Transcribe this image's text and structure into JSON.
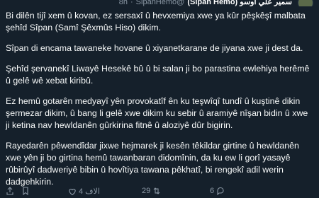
{
  "tweet": {
    "author_name": "(Sîpan Hemo) سمير علي اوسو",
    "handle": "SipanHemo@",
    "time": "8h",
    "dot": "·",
    "paragraphs": [
      "Bi dilên tijî xem û kovan, ez sersaxî û hevxemiya xwe ya kûr pêşkêşî malbata şehîd Sîpan (Samî Şêxmûs Hiso) dikim.",
      "Sîpan di encama tawaneke hovane û xiyanetkarane de jiyana xwe ji dest da.",
      "Şehîd şervanekî Liwayê Hesekê bû û bi salan ji bo parastina ewlehiya herêmê û gelê wê xebat kiribû.",
      "Ez hemû gotarên medyayî yên provokatîf ên ku teşwîqî tundî û kuştinê dikin şermezar dikim, û bang li gelê xwe dikim ku sebir û aramiyê nîşan bidin û xwe ji ketina nav hewldanên gûrkirina fitnê û aloziyê dûr bigirin.",
      "Rayedarên pêwendîdar jixwe hejmarek ji kesên têkildar girtine û hewldanên xwe yên ji bo girtina hemû tawanbaran didomînin, da ku ew li gorî yasayê rûbirûyî dadweriyê bibin û hovîtiya tawana pêkhatî, bi rengekî adil werin dadgehkirin."
    ]
  },
  "actions": {
    "replies": "6",
    "retweets": "29",
    "likes": "الاف 4",
    "views": ""
  }
}
